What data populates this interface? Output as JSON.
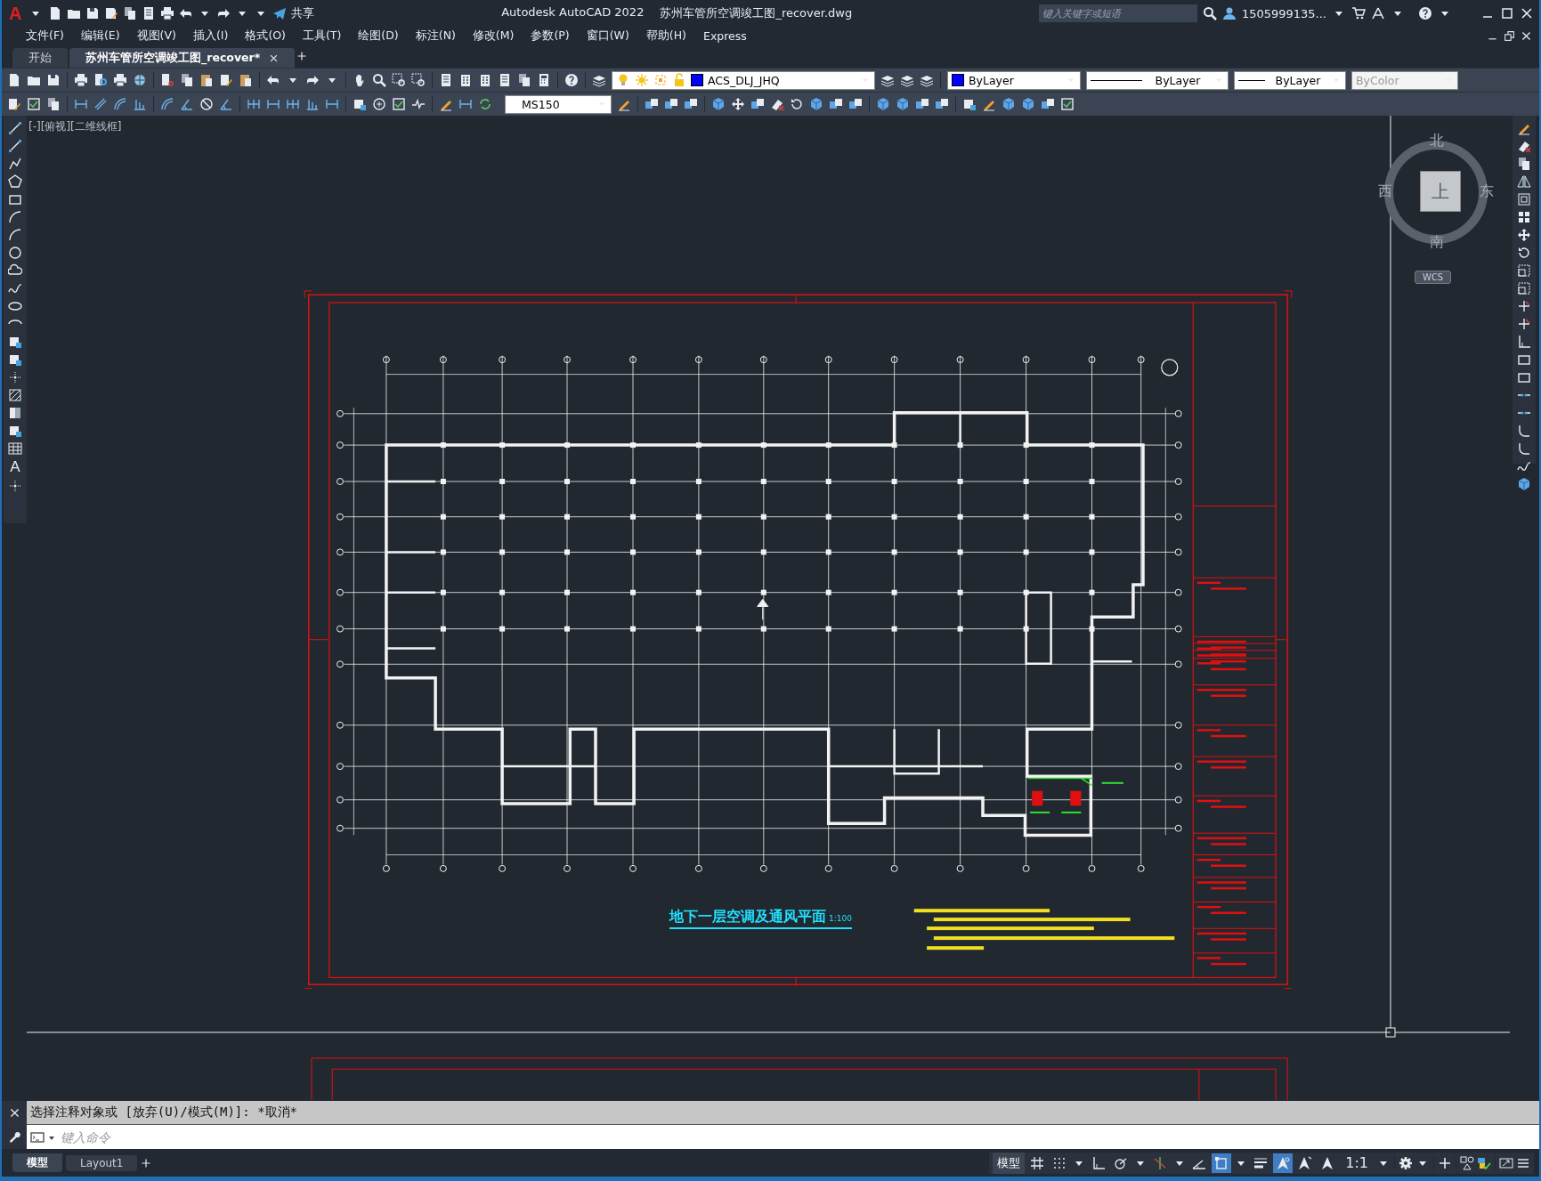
{
  "app_button": {
    "label": "A"
  },
  "title_bar": {
    "share": "共享",
    "app_title": "Autodesk AutoCAD 2022",
    "file_title": "苏州车管所空调竣工图_recover.dwg",
    "search": {
      "placeholder": "键入关键字或短语"
    },
    "user": "1505999135..."
  },
  "menus": [
    "文件(F)",
    "编辑(E)",
    "视图(V)",
    "插入(I)",
    "格式(O)",
    "工具(T)",
    "绘图(D)",
    "标注(N)",
    "修改(M)",
    "参数(P)",
    "窗口(W)",
    "帮助(H)",
    "Express"
  ],
  "file_tabs": [
    {
      "label": "开始",
      "selected": false
    },
    {
      "label": "苏州车管所空调竣工图_recover*",
      "selected": true
    }
  ],
  "properties": {
    "layer": "ACS_DLJ_JHQ",
    "color_setting": "ByLayer",
    "linetype": "ByLayer",
    "lineweight": "ByLayer",
    "plot_style": {
      "value": "ByColor",
      "disabled": true
    }
  },
  "dim_style": "MS150",
  "draw_toolbar": {
    "text_tool": "A"
  },
  "viewport_label": "[-][俯视][二维线框]",
  "viewcube": {
    "north": "北",
    "south": "南",
    "west": "西",
    "east": "东",
    "face": "上",
    "ucs": "WCS"
  },
  "drawing": {
    "title": "地下一层空调及通风平面",
    "scale": "1:100"
  },
  "command_line": {
    "history": "选择注释对象或 [放弃(U)/模式(M)]: *取消*",
    "placeholder": "键入命令"
  },
  "layout_tabs": [
    {
      "label": "模型",
      "selected": true
    },
    {
      "label": "Layout1",
      "selected": false
    }
  ],
  "status_bar": {
    "model": "模型",
    "annotation_scale": "1:1",
    "toggles": [
      {
        "kind": "grid",
        "on": false
      },
      {
        "kind": "snap",
        "on": false
      },
      {
        "kind": "ortho",
        "on": false
      },
      {
        "kind": "polar",
        "on": false
      },
      {
        "kind": "tracking",
        "on": false
      },
      {
        "kind": "angle",
        "on": false
      },
      {
        "kind": "osnap",
        "on": true
      },
      {
        "kind": "lineweight",
        "on": false
      },
      {
        "kind": "annotation",
        "on": true
      },
      {
        "kind": "autoscale",
        "on": false
      },
      {
        "kind": "annoscale",
        "on": false
      }
    ]
  }
}
